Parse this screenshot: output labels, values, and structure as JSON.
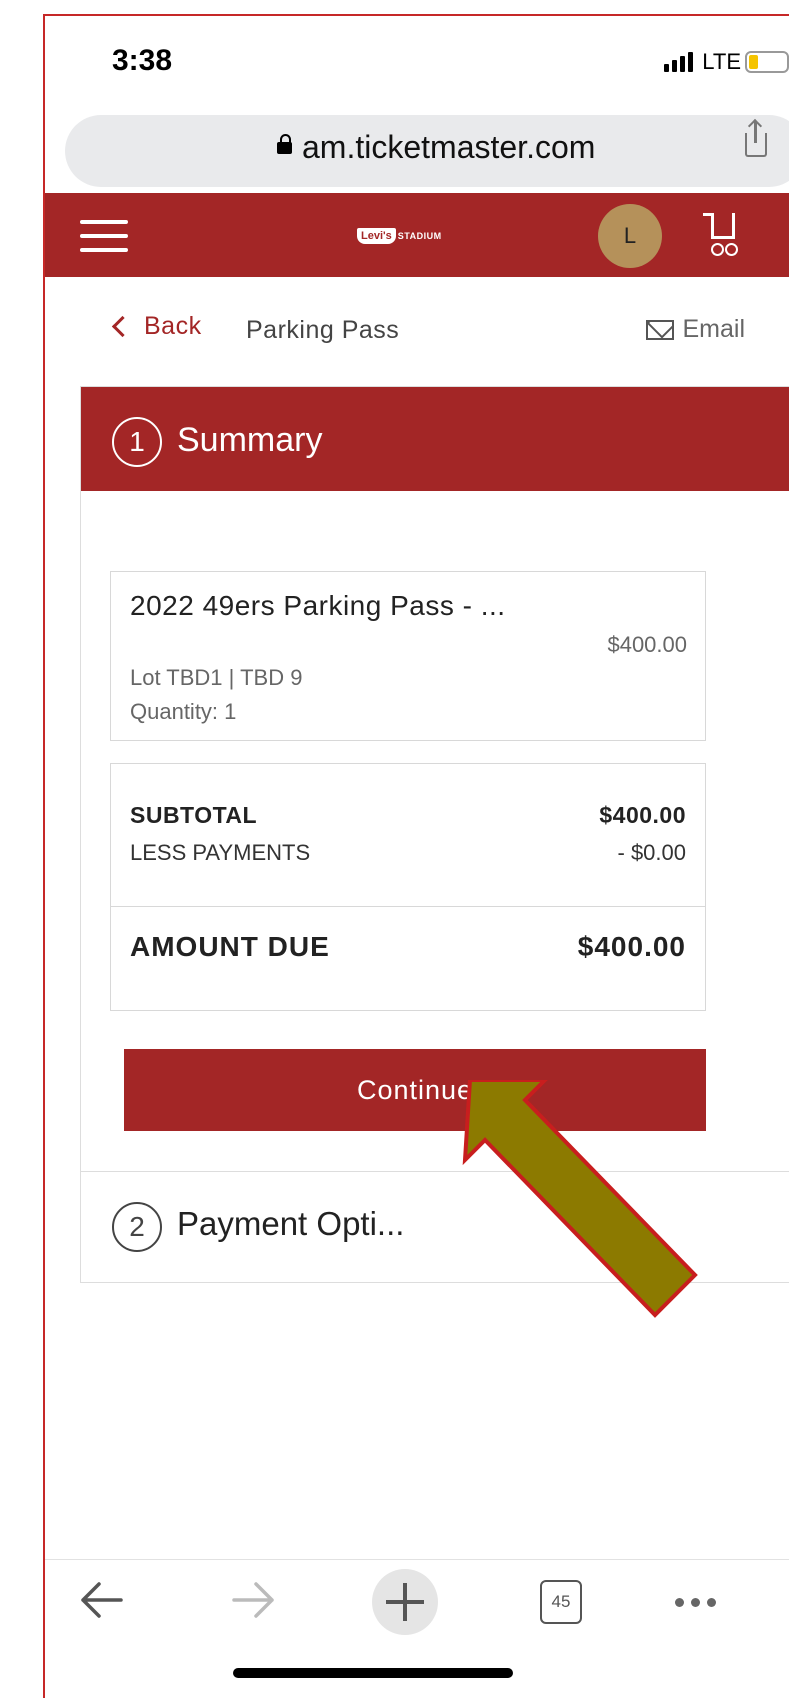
{
  "status_bar": {
    "time": "3:38",
    "network": "LTE"
  },
  "browser": {
    "url": "am.ticketmaster.com"
  },
  "header": {
    "logo_brand": "Levi's",
    "logo_stadium": "STADIUM",
    "avatar_initial": "L"
  },
  "breadcrumb": {
    "back_label": "Back",
    "title": "Parking Pass",
    "email_label": "Email"
  },
  "summary": {
    "step_number": "1",
    "title": "Summary",
    "item": {
      "name": "2022 49ers Parking Pass - ...",
      "price": "$400.00",
      "lot": "Lot TBD1 | TBD 9",
      "quantity": "Quantity: 1"
    },
    "totals": {
      "subtotal_label": "SUBTOTAL",
      "subtotal_value": "$400.00",
      "less_payments_label": "LESS PAYMENTS",
      "less_payments_value": "- $0.00",
      "amount_due_label": "AMOUNT DUE",
      "amount_due_value": "$400.00"
    },
    "continue_label": "Continue"
  },
  "payment": {
    "step_number": "2",
    "title": "Payment Opti..."
  },
  "toolbar": {
    "tabs_count": "45"
  },
  "colors": {
    "brand": "#a32626",
    "annotation_arrow": "#8c7a00"
  }
}
